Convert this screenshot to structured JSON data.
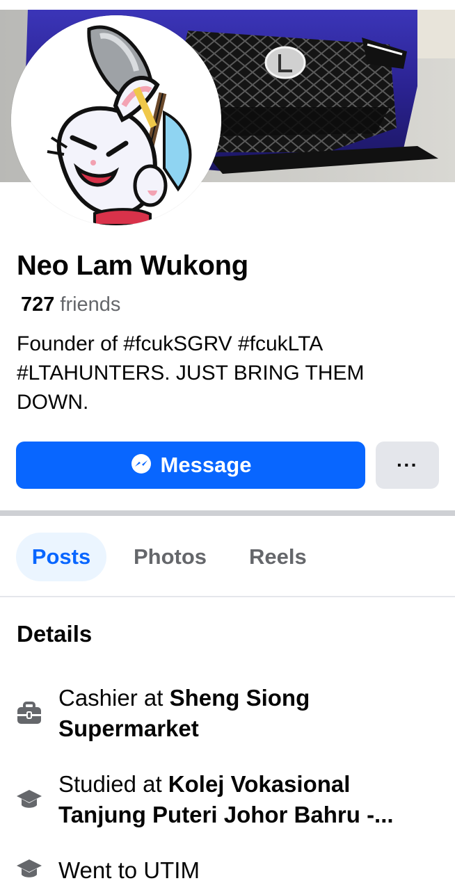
{
  "profile": {
    "name": "Neo Lam Wukong",
    "friends_count": "727",
    "friends_label": "friends",
    "bio": "Founder of #fcukSGRV #fcukLTA #LTAHUNTERS. JUST BRING THEM DOWN."
  },
  "actions": {
    "message_label": "Message",
    "more_label": "···"
  },
  "tabs": [
    {
      "label": "Posts",
      "active": true
    },
    {
      "label": "Photos",
      "active": false
    },
    {
      "label": "Reels",
      "active": false
    }
  ],
  "details": {
    "title": "Details",
    "items": [
      {
        "icon": "briefcase-icon",
        "prefix": "Cashier at ",
        "bold": "Sheng Siong Supermarket"
      },
      {
        "icon": "graduation-cap-icon",
        "prefix": "Studied at ",
        "bold": "Kolej Vokasional Tanjung Puteri Johor Bahru -..."
      },
      {
        "icon": "graduation-cap-icon",
        "prefix": "Went to UTIM",
        "bold": ""
      }
    ]
  },
  "colors": {
    "accent": "#0866ff",
    "accent_soft": "#ebf5ff",
    "secondary_text": "#65676b",
    "button_grey": "#e4e6eb"
  }
}
